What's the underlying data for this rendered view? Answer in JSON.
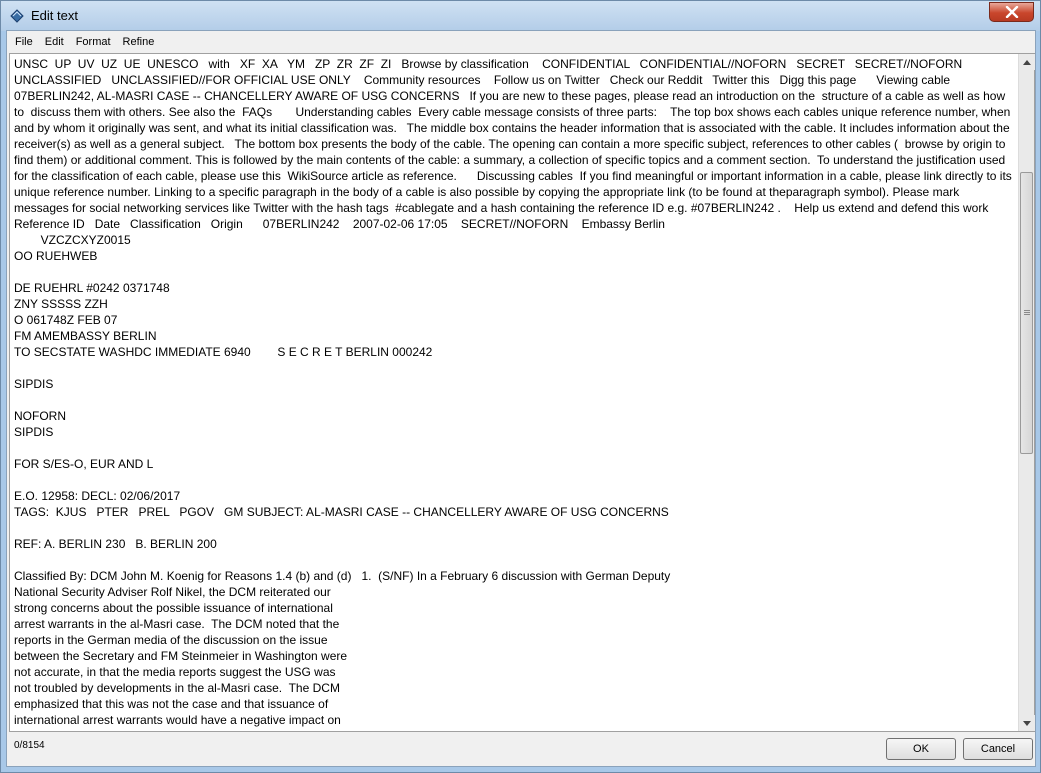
{
  "window": {
    "title": "Edit text",
    "icon": "feather-icon"
  },
  "menu": [
    "File",
    "Edit",
    "Format",
    "Refine"
  ],
  "editor": {
    "content": "UNSC  UP  UV  UZ  UE  UNESCO   with   XF  XA   YM   ZP  ZR  ZF  ZI   Browse by classification    CONFIDENTIAL   CONFIDENTIAL//NOFORN   SECRET   SECRET//NOFORN   UNCLASSIFIED   UNCLASSIFIED//FOR OFFICIAL USE ONLY    Community resources    Follow us on Twitter   Check our Reddit   Twitter this   Digg this page      Viewing cable 07BERLIN242, AL-MASRI CASE -- CHANCELLERY AWARE OF USG CONCERNS   If you are new to these pages, please read an introduction on the  structure of a cable as well as how to  discuss them with others. See also the  FAQs       Understanding cables  Every cable message consists of three parts:    The top box shows each cables unique reference number, when and by whom it originally was sent, and what its initial classification was.   The middle box contains the header information that is associated with the cable. It includes information about the receiver(s) as well as a general subject.   The bottom box presents the body of the cable. The opening can contain a more specific subject, references to other cables (  browse by origin to find them) or additional comment. This is followed by the main contents of the cable: a summary, a collection of specific topics and a comment section.  To understand the justification used for the classification of each cable, please use this  WikiSource article as reference.      Discussing cables  If you find meaningful or important information in a cable, please link directly to its unique reference number. Linking to a specific paragraph in the body of a cable is also possible by copying the appropriate link (to be found at theparagraph symbol). Please mark messages for social networking services like Twitter with the hash tags  #cablegate and a hash containing the reference ID e.g. #07BERLIN242 .    Help us extend and defend this work      Reference ID   Date   Classification   Origin      07BERLIN242    2007-02-06 17:05    SECRET//NOFORN    Embassy Berlin\n        VZCZCXYZ0015\nOO RUEHWEB\n\nDE RUEHRL #0242 0371748\nZNY SSSSS ZZH\nO 061748Z FEB 07\nFM AMEMBASSY BERLIN\nTO SECSTATE WASHDC IMMEDIATE 6940        S E C R E T BERLIN 000242\n\nSIPDIS\n\nNOFORN\nSIPDIS\n\nFOR S/ES-O, EUR AND L\n\nE.O. 12958: DECL: 02/06/2017\nTAGS:  KJUS   PTER   PREL   PGOV   GM SUBJECT: AL-MASRI CASE -- CHANCELLERY AWARE OF USG CONCERNS\n\nREF: A. BERLIN 230   B. BERLIN 200\n\nClassified By: DCM John M. Koenig for Reasons 1.4 (b) and (d)   1.  (S/NF) In a February 6 discussion with German Deputy\nNational Security Adviser Rolf Nikel, the DCM reiterated our\nstrong concerns about the possible issuance of international\narrest warrants in the al-Masri case.  The DCM noted that the\nreports in the German media of the discussion on the issue\nbetween the Secretary and FM Steinmeier in Washington were\nnot accurate, in that the media reports suggest the USG was\nnot troubled by developments in the al-Masri case.  The DCM\nemphasized that this was not the case and that issuance of\ninternational arrest warrants would have a negative impact on"
  },
  "status": {
    "counter": "0/8154"
  },
  "buttons": {
    "ok": "OK",
    "cancel": "Cancel"
  },
  "colors": {
    "titlebar": "#b3cde8",
    "close": "#c9462c"
  }
}
